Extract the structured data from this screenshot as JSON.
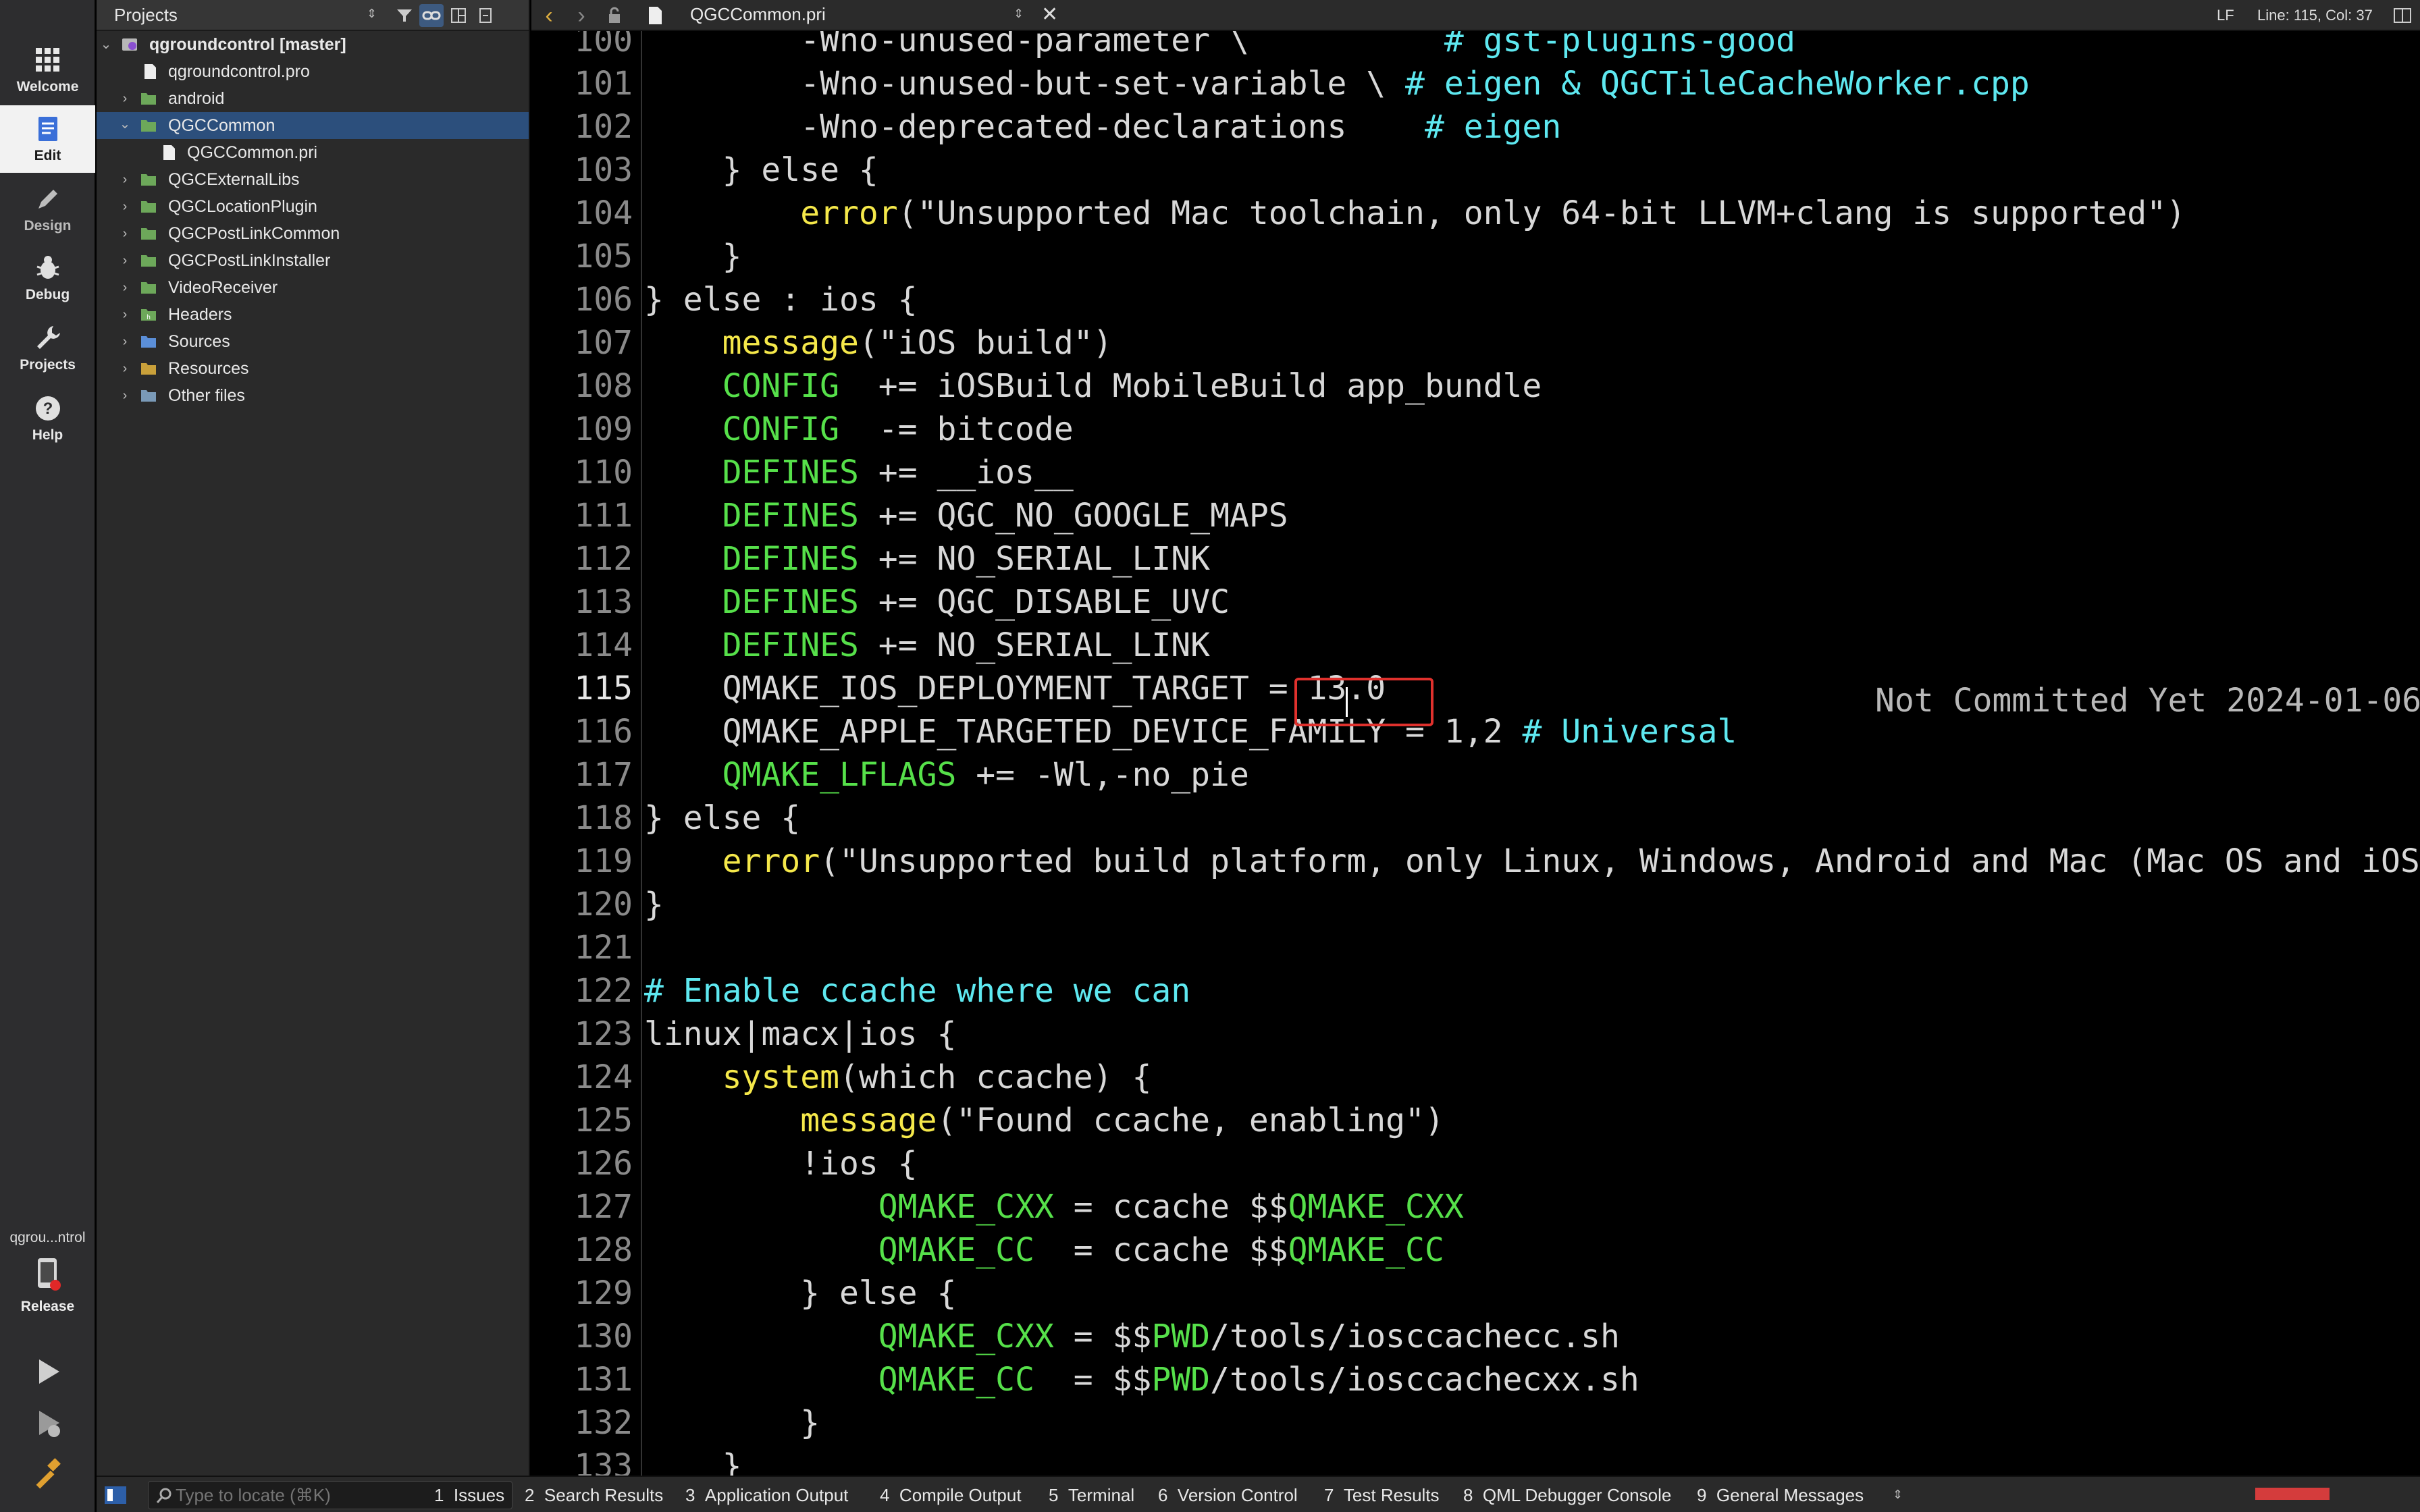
{
  "modes": [
    {
      "label": "Welcome",
      "icon": "grid-icon"
    },
    {
      "label": "Edit",
      "icon": "document-icon"
    },
    {
      "label": "Design",
      "icon": "pencil-icon"
    },
    {
      "label": "Debug",
      "icon": "bug-icon"
    },
    {
      "label": "Projects",
      "icon": "wrench-icon"
    },
    {
      "label": "Help",
      "icon": "help-icon"
    }
  ],
  "kit": {
    "name": "qgrou...ntrol",
    "build": "Release"
  },
  "projects_panel": {
    "title": "Projects",
    "tree": [
      {
        "label": "qgroundcontrol [master]",
        "type": "project"
      },
      {
        "label": "qgroundcontrol.pro",
        "type": "file"
      },
      {
        "label": "android",
        "type": "folder"
      },
      {
        "label": "QGCCommon",
        "type": "folder",
        "selected": true
      },
      {
        "label": "QGCCommon.pri",
        "type": "file"
      },
      {
        "label": "QGCExternalLibs",
        "type": "folder"
      },
      {
        "label": "QGCLocationPlugin",
        "type": "folder"
      },
      {
        "label": "QGCPostLinkCommon",
        "type": "folder"
      },
      {
        "label": "QGCPostLinkInstaller",
        "type": "folder"
      },
      {
        "label": "VideoReceiver",
        "type": "folder"
      },
      {
        "label": "Headers",
        "type": "folder"
      },
      {
        "label": "Sources",
        "type": "folder"
      },
      {
        "label": "Resources",
        "type": "folder"
      },
      {
        "label": "Other files",
        "type": "folder"
      }
    ]
  },
  "editor": {
    "file_name": "QGCCommon.pri",
    "line_ending": "LF",
    "cursor_pos": "Line: 115, Col: 37",
    "blame": "Not Committed Yet 2024-01-06",
    "current_line": 115,
    "lines": [
      {
        "n": "100",
        "p": [
          "        -Wno-unused-parameter \\          ",
          {
            "c": "cm",
            "t": "# gst-plugins-good"
          }
        ]
      },
      {
        "n": "101",
        "p": [
          "        -Wno-unused-but-set-variable \\ ",
          {
            "c": "cm",
            "t": "# eigen & QGCTileCacheWorker.cpp"
          }
        ]
      },
      {
        "n": "102",
        "p": [
          "        -Wno-deprecated-declarations    ",
          {
            "c": "cm",
            "t": "# eigen"
          }
        ]
      },
      {
        "n": "103",
        "p": [
          "    } else {"
        ]
      },
      {
        "n": "104",
        "p": [
          "        ",
          {
            "c": "fn",
            "t": "error"
          },
          "(\"Unsupported Mac toolchain, only 64-bit LLVM+clang is supported\")"
        ]
      },
      {
        "n": "105",
        "p": [
          "    }"
        ]
      },
      {
        "n": "106",
        "p": [
          "} else : ios {"
        ]
      },
      {
        "n": "107",
        "p": [
          "    ",
          {
            "c": "fn",
            "t": "message"
          },
          "(\"iOS build\")"
        ]
      },
      {
        "n": "108",
        "p": [
          "    ",
          {
            "c": "kw",
            "t": "CONFIG"
          },
          "  += iOSBuild MobileBuild app_bundle"
        ]
      },
      {
        "n": "109",
        "p": [
          "    ",
          {
            "c": "kw",
            "t": "CONFIG"
          },
          "  -= bitcode"
        ]
      },
      {
        "n": "110",
        "p": [
          "    ",
          {
            "c": "kw",
            "t": "DEFINES"
          },
          " += __ios__"
        ]
      },
      {
        "n": "111",
        "p": [
          "    ",
          {
            "c": "kw",
            "t": "DEFINES"
          },
          " += QGC_NO_GOOGLE_MAPS"
        ]
      },
      {
        "n": "112",
        "p": [
          "    ",
          {
            "c": "kw",
            "t": "DEFINES"
          },
          " += NO_SERIAL_LINK"
        ]
      },
      {
        "n": "113",
        "p": [
          "    ",
          {
            "c": "kw",
            "t": "DEFINES"
          },
          " += QGC_DISABLE_UVC"
        ]
      },
      {
        "n": "114",
        "p": [
          "    ",
          {
            "c": "kw",
            "t": "DEFINES"
          },
          " += NO_SERIAL_LINK"
        ]
      },
      {
        "n": "115",
        "p": [
          "    QMAKE_IOS_DEPLOYMENT_TARGET = 13.0"
        ]
      },
      {
        "n": "116",
        "p": [
          "    QMAKE_APPLE_TARGETED_DEVICE_FAMILY = 1,2 ",
          {
            "c": "cm",
            "t": "# Universal"
          }
        ]
      },
      {
        "n": "117",
        "p": [
          "    ",
          {
            "c": "kw",
            "t": "QMAKE_LFLAGS"
          },
          " += -Wl,-no_pie"
        ]
      },
      {
        "n": "118",
        "p": [
          "} else {"
        ]
      },
      {
        "n": "119",
        "p": [
          "    ",
          {
            "c": "fn",
            "t": "error"
          },
          "(\"Unsupported build platform, only Linux, Windows, Android and Mac (Mac OS and iOS)"
        ]
      },
      {
        "n": "120",
        "p": [
          "}"
        ]
      },
      {
        "n": "121",
        "p": [
          ""
        ]
      },
      {
        "n": "122",
        "p": [
          {
            "c": "cm",
            "t": "# Enable ccache where we can"
          }
        ]
      },
      {
        "n": "123",
        "p": [
          "linux|macx|ios {"
        ]
      },
      {
        "n": "124",
        "p": [
          "    ",
          {
            "c": "fn",
            "t": "system"
          },
          "(which ccache) {"
        ]
      },
      {
        "n": "125",
        "p": [
          "        ",
          {
            "c": "fn",
            "t": "message"
          },
          "(\"Found ccache, enabling\")"
        ]
      },
      {
        "n": "126",
        "p": [
          "        !ios {"
        ]
      },
      {
        "n": "127",
        "p": [
          "            ",
          {
            "c": "kw",
            "t": "QMAKE_CXX"
          },
          " = ccache $$",
          {
            "c": "kw",
            "t": "QMAKE_CXX"
          }
        ]
      },
      {
        "n": "128",
        "p": [
          "            ",
          {
            "c": "kw",
            "t": "QMAKE_CC"
          },
          "  = ccache $$",
          {
            "c": "kw",
            "t": "QMAKE_CC"
          }
        ]
      },
      {
        "n": "129",
        "p": [
          "        } else {"
        ]
      },
      {
        "n": "130",
        "p": [
          "            ",
          {
            "c": "kw",
            "t": "QMAKE_CXX"
          },
          " = $$",
          {
            "c": "kw",
            "t": "PWD"
          },
          "/tools/iosccachecc.sh"
        ]
      },
      {
        "n": "131",
        "p": [
          "            ",
          {
            "c": "kw",
            "t": "QMAKE_CC"
          },
          "  = $$",
          {
            "c": "kw",
            "t": "PWD"
          },
          "/tools/iosccachecxx.sh"
        ]
      },
      {
        "n": "132",
        "p": [
          "        }"
        ]
      },
      {
        "n": "133",
        "p": [
          "    }"
        ]
      }
    ]
  },
  "output_bar": {
    "locator_placeholder": "Type to locate (⌘K)",
    "panes": [
      {
        "num": "1",
        "label": "Issues"
      },
      {
        "num": "2",
        "label": "Search Results"
      },
      {
        "num": "3",
        "label": "Application Output"
      },
      {
        "num": "4",
        "label": "Compile Output"
      },
      {
        "num": "5",
        "label": "Terminal"
      },
      {
        "num": "6",
        "label": "Version Control"
      },
      {
        "num": "7",
        "label": "Test Results"
      },
      {
        "num": "8",
        "label": "QML Debugger Console"
      },
      {
        "num": "9",
        "label": "General Messages"
      }
    ]
  },
  "colors": {
    "keyword": "#56e04a",
    "function": "#f5e84a",
    "comment": "#5ee8f0",
    "selection": "#2c4f7c",
    "highlight_box": "#e0312d"
  }
}
